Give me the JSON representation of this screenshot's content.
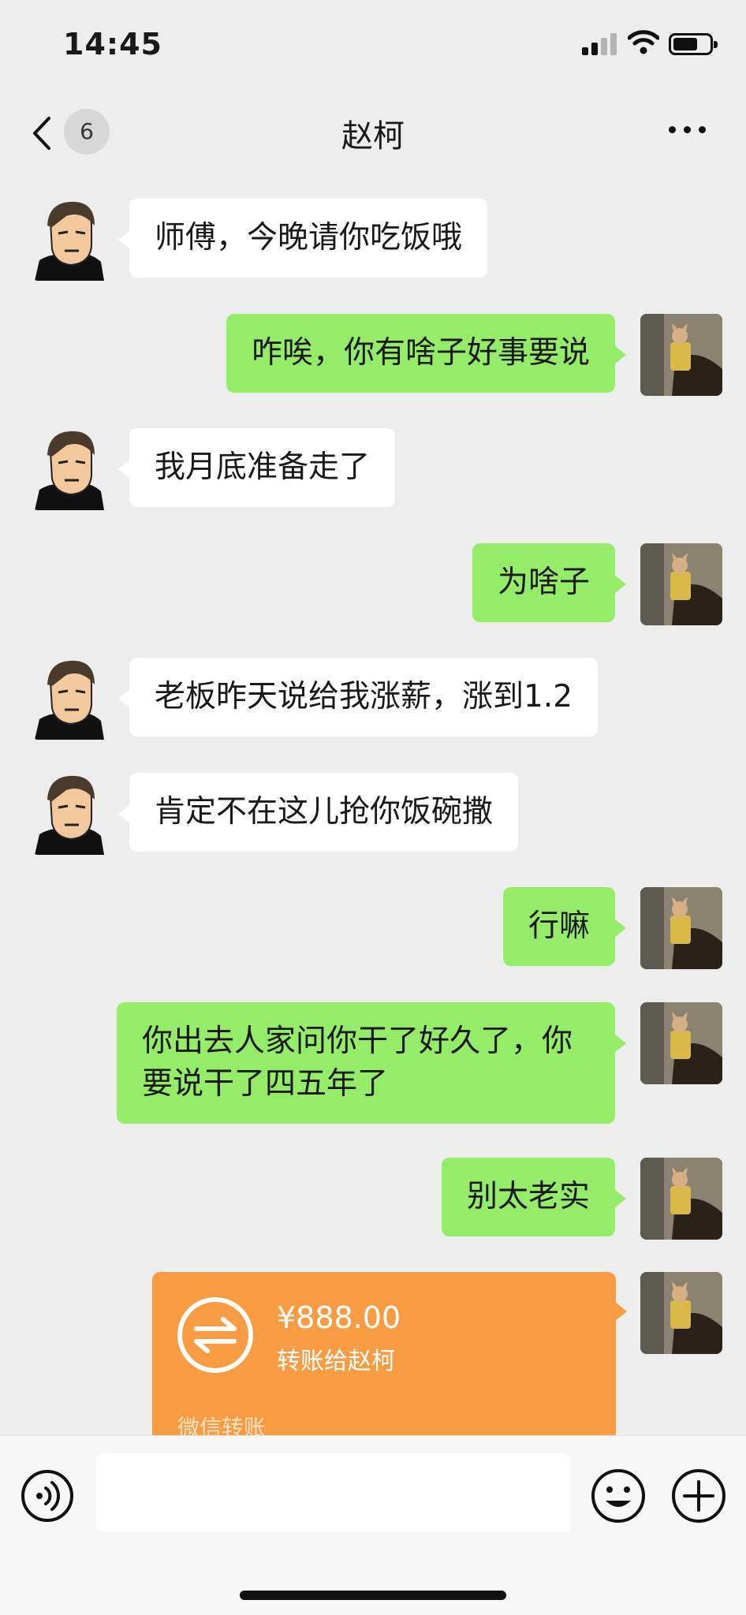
{
  "status_bar": {
    "time": "14:45"
  },
  "nav": {
    "unread_count": "6",
    "title": "赵柯"
  },
  "messages": [
    {
      "side": "left",
      "text": "师傅，今晚请你吃饭哦"
    },
    {
      "side": "right",
      "text": "咋唉，你有啥子好事要说"
    },
    {
      "side": "left",
      "text": "我月底准备走了"
    },
    {
      "side": "right",
      "text": "为啥子"
    },
    {
      "side": "left",
      "text": "老板昨天说给我涨薪，涨到1.2"
    },
    {
      "side": "left",
      "text": "肯定不在这儿抢你饭碗撒"
    },
    {
      "side": "right",
      "text": "行嘛"
    },
    {
      "side": "right",
      "text": "你出去人家问你干了好久了，你要说干了四五年了"
    },
    {
      "side": "right",
      "text": "别太老实"
    }
  ],
  "transfer": {
    "amount": "¥888.00",
    "recipient": "转账给赵柯",
    "label": "微信转账"
  },
  "input": {
    "placeholder": ""
  },
  "colors": {
    "sent_bubble": "#95ec69",
    "received_bubble": "#ffffff",
    "transfer_card": "#f79c42",
    "background": "#ededed"
  },
  "icons": {
    "back": "chevron-left-icon",
    "more": "ellipsis-icon",
    "voice": "voice-icon",
    "emoji": "emoji-icon",
    "plus": "plus-icon"
  }
}
